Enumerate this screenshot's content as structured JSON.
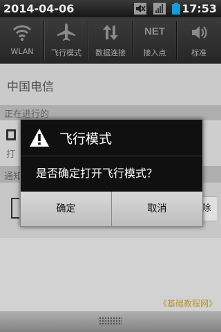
{
  "statusbar": {
    "date": "2014-04-06",
    "time": "17:53"
  },
  "toggles": [
    {
      "label": "WLAN"
    },
    {
      "label": "飞行模式"
    },
    {
      "label": "数据连接"
    },
    {
      "label": "接入点",
      "icon_text": "NET"
    },
    {
      "label": "标准"
    }
  ],
  "carrier": "中国电信",
  "ongoing": {
    "header": "正在进行的",
    "item_text": "打"
  },
  "notifications": {
    "header": "通知",
    "clear_label": "除"
  },
  "watermark": "《基础教程网》",
  "dialog": {
    "title": "飞行模式",
    "message": "是否确定打开飞行模式？",
    "ok": "确定",
    "cancel": "取消"
  }
}
